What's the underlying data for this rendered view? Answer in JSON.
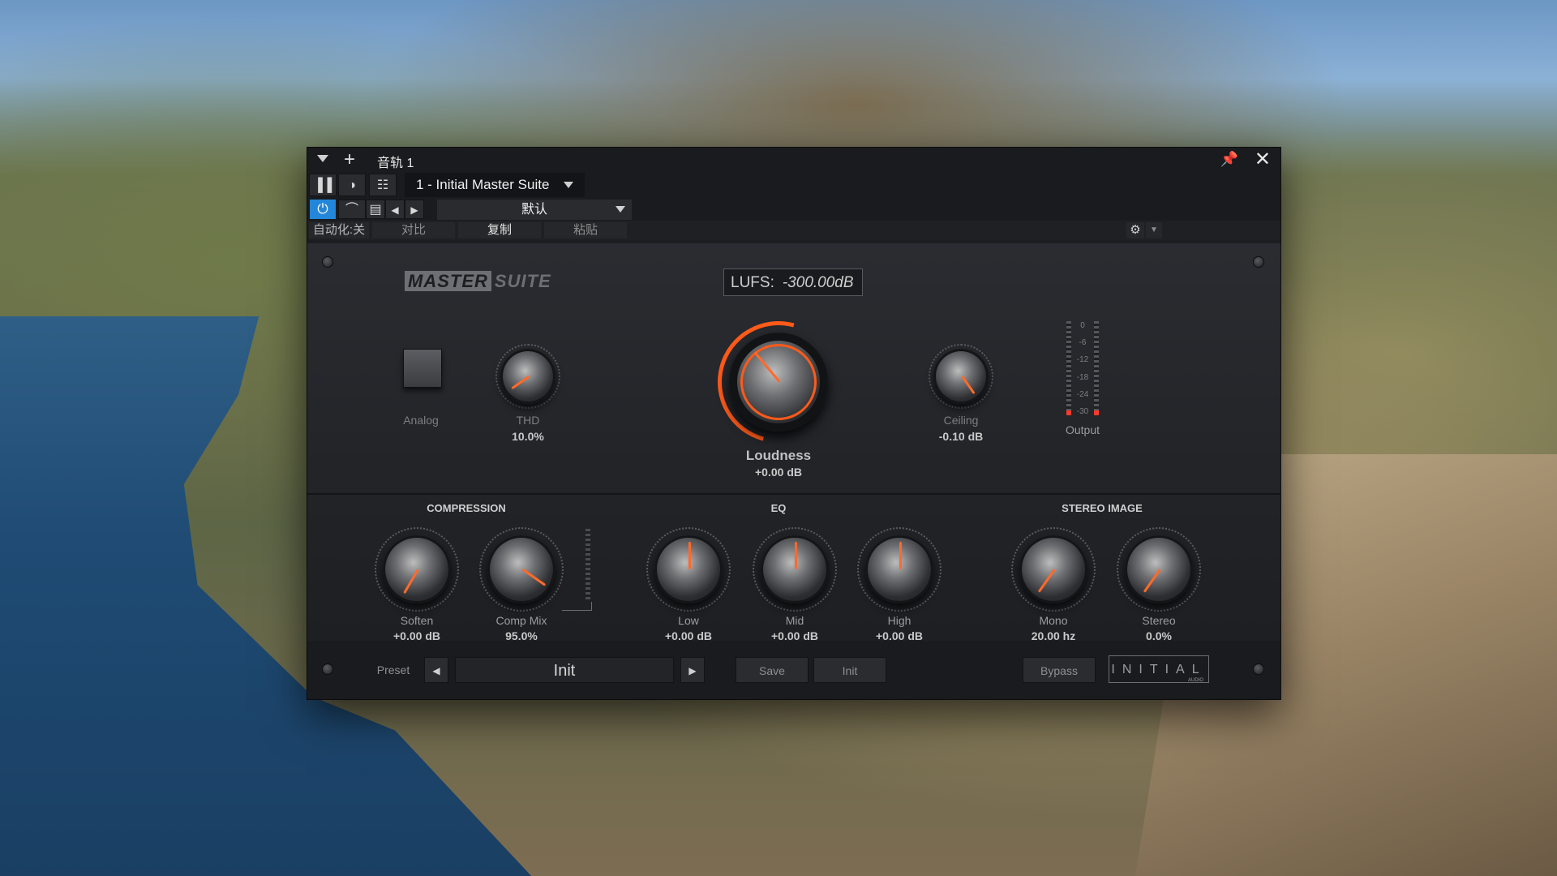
{
  "window": {
    "title": "音轨 1",
    "plugin_name": "1 - Initial Master Suite",
    "preset_default": "默认",
    "automation_label": "自动化:关",
    "compare_label": "对比",
    "copy_label": "复制",
    "paste_label": "粘贴"
  },
  "plugin": {
    "logo_a": "MASTER",
    "logo_b": "SUITE",
    "lufs_label": "LUFS:",
    "lufs_value": "-300.00dB",
    "analog_label": "Analog",
    "thd_label": "THD",
    "thd_value": "10.0%",
    "loudness_label": "Loudness",
    "loudness_value": "+0.00 dB",
    "ceiling_label": "Ceiling",
    "ceiling_value": "-0.10 dB",
    "output_label": "Output",
    "meter_scale": [
      "0",
      "-6",
      "-12",
      "-18",
      "-24",
      "-30"
    ],
    "sections": {
      "compression": "COMPRESSION",
      "eq": "EQ",
      "stereo": "STEREO IMAGE"
    },
    "knobs": {
      "soften": {
        "label": "Soften",
        "value": "+0.00 dB"
      },
      "compmix": {
        "label": "Comp Mix",
        "value": "95.0%"
      },
      "low": {
        "label": "Low",
        "value": "+0.00 dB"
      },
      "mid": {
        "label": "Mid",
        "value": "+0.00 dB"
      },
      "high": {
        "label": "High",
        "value": "+0.00 dB"
      },
      "mono": {
        "label": "Mono",
        "value": "20.00 hz"
      },
      "stereo": {
        "label": "Stereo",
        "value": "0.0%"
      }
    },
    "bottom": {
      "preset_label": "Preset",
      "preset_value": "Init",
      "save_label": "Save",
      "init_label": "Init",
      "bypass_label": "Bypass",
      "brand_text": "INITIAL",
      "brand_sub": "AUDIO"
    }
  },
  "colors": {
    "accent_orange": "#ff6a2a",
    "power_blue": "#2486d9",
    "panel_bg": "#222428"
  }
}
